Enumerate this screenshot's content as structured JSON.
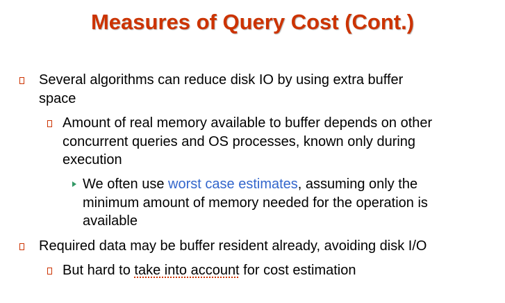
{
  "title": "Measures of Query Cost (Cont.)",
  "colors": {
    "title": "#cc3300",
    "bullet_box": "#cc3300",
    "bullet_arrow": "#339966",
    "highlight": "#3366cc"
  },
  "bullets": [
    {
      "level": 1,
      "icon": "square-bullet-icon",
      "lines": [
        "Several algorithms can reduce disk IO by using extra buffer",
        "space"
      ]
    },
    {
      "level": 2,
      "icon": "square-bullet-icon",
      "lines": [
        "Amount of real memory available to buffer depends on other",
        "concurrent queries and OS processes, known only during",
        "execution"
      ]
    },
    {
      "level": 3,
      "icon": "arrow-bullet-icon",
      "line1_pre": "We often use ",
      "line1_highlight": "worst case estimates",
      "line1_post": ", assuming only the",
      "lines_rest": [
        "minimum amount of memory needed for the operation is",
        "available"
      ]
    },
    {
      "level": 1,
      "icon": "square-bullet-icon",
      "lines": [
        "Required data may be buffer resident already, avoiding disk I/O"
      ]
    },
    {
      "level": 2,
      "icon": "square-bullet-icon",
      "pre": "But hard to ",
      "squiggle": "take into account",
      "post": " for cost estimation"
    }
  ]
}
